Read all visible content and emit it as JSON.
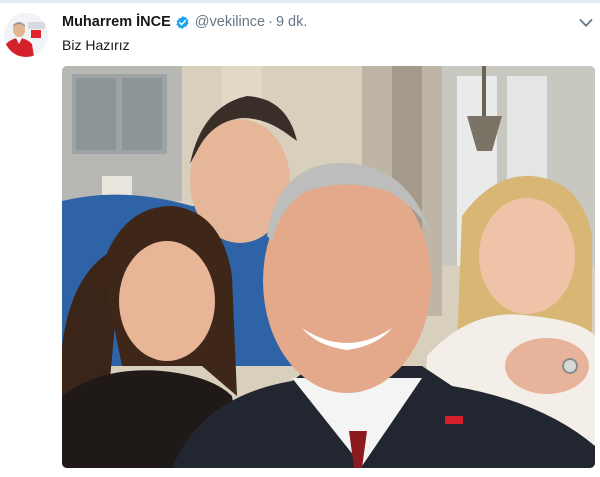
{
  "tweet": {
    "display_name": "Muharrem İNCE",
    "handle": "@vekilince",
    "separator": "·",
    "timestamp": "9 dk.",
    "text": "Biz Hazırız",
    "verified": true
  },
  "icons": {
    "verified": "verified-badge-icon",
    "menu": "chevron-down-icon"
  },
  "colors": {
    "text_primary": "#14171a",
    "text_secondary": "#657786",
    "verified_blue": "#1da1f2",
    "divider": "#e6ecf0"
  }
}
